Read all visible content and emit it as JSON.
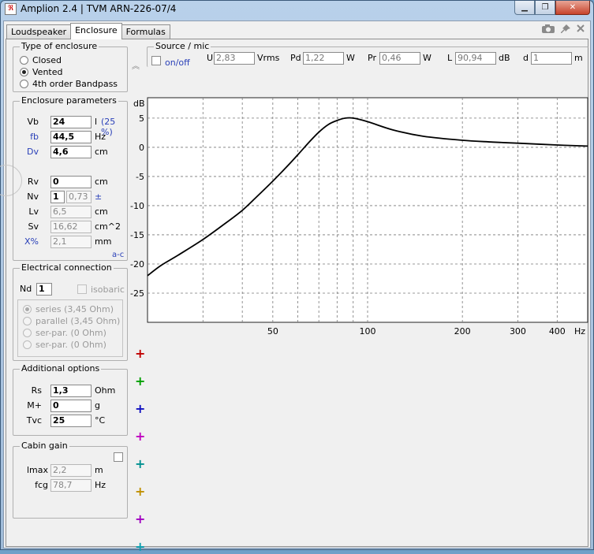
{
  "window": {
    "title": "Amplion 2.4 | TVM ARN-226-07/4",
    "app_icon_text": "ℜ",
    "minimize_glyph": "▁",
    "maximize_glyph": "❐",
    "close_glyph": "✕"
  },
  "tabs": [
    "Loudspeaker",
    "Enclosure",
    "Formulas"
  ],
  "active_tab": "Enclosure",
  "toolbar_icons": [
    "camera-icon",
    "pin-icon",
    "close-icon"
  ],
  "enclosure_type": {
    "title": "Type of enclosure",
    "options": [
      "Closed",
      "Vented",
      "4th order Bandpass"
    ],
    "selected": "Vented"
  },
  "enclosure_params": {
    "title": "Enclosure parameters",
    "Vb": {
      "label": "Vb",
      "value": "24",
      "unit": "l",
      "extra": "(25 %)"
    },
    "fb": {
      "label": "fb",
      "value": "44,5",
      "unit": "Hz"
    },
    "Dv": {
      "label": "Dv",
      "value": "4,6",
      "unit": "cm"
    },
    "Rv": {
      "label": "Rv",
      "value": "0",
      "unit": "cm"
    },
    "Nv": {
      "label": "Nv",
      "value": "1",
      "value2": "0,73",
      "unit": "±"
    },
    "Lv": {
      "label": "Lv",
      "value": "6,5",
      "unit": "cm"
    },
    "Sv": {
      "label": "Sv",
      "value": "16,62",
      "unit": "cm^2"
    },
    "Xpct": {
      "label": "X%",
      "value": "2,1",
      "unit": "mm"
    },
    "ac_label": "a-c"
  },
  "electrical": {
    "title": "Electrical connection",
    "nd_label": "Nd",
    "nd_value": "1",
    "isobaric_label": "isobaric",
    "options": [
      "series (3,45 Ohm)",
      "parallel (3,45 Ohm)",
      "ser-par. (0 Ohm)",
      "ser-par. (0 Ohm)"
    ],
    "selected": "series (3,45 Ohm)"
  },
  "additional": {
    "title": "Additional options",
    "Rs": {
      "label": "Rs",
      "value": "1,3",
      "unit": "Ohm"
    },
    "Mplus": {
      "label": "M+",
      "value": "0",
      "unit": "g"
    },
    "Tvc": {
      "label": "Tvc",
      "value": "25",
      "unit": "°C"
    }
  },
  "cabin": {
    "title": "Cabin gain",
    "lmax": {
      "label": "lmax",
      "value": "2,2",
      "unit": "m"
    },
    "fcg": {
      "label": "fcg",
      "value": "78,7",
      "unit": "Hz"
    }
  },
  "source": {
    "title": "Source / mic",
    "onoff_label": "on/off",
    "U": {
      "label": "U",
      "value": "2,83",
      "unit": "Vrms"
    },
    "Pd": {
      "label": "Pd",
      "value": "1,22",
      "unit": "W"
    },
    "Pr": {
      "label": "Pr",
      "value": "0,46",
      "unit": "W"
    },
    "L": {
      "label": "L",
      "value": "90,94",
      "unit": "dB"
    },
    "d": {
      "label": "d",
      "value": "1",
      "unit": "m"
    }
  },
  "curve_add_buttons": [
    {
      "color": "#c00000"
    },
    {
      "color": "#00a000"
    },
    {
      "color": "#1010c0"
    },
    {
      "color": "#c000c0"
    },
    {
      "color": "#009090"
    },
    {
      "color": "#c09000"
    },
    {
      "color": "#a000c0"
    },
    {
      "color": "#10a0b0"
    }
  ],
  "chart_data": {
    "type": "line",
    "xscale": "log",
    "xlim": [
      20,
      500
    ],
    "ylim": [
      -30,
      8.5
    ],
    "ylabel": "dB",
    "xlabel": "Hz",
    "yticks": [
      5,
      0,
      -5,
      -10,
      -15,
      -20,
      -25
    ],
    "xticks_labeled": [
      50,
      100,
      200,
      300,
      400
    ],
    "xgrid": [
      30,
      40,
      50,
      60,
      70,
      80,
      90,
      100,
      200,
      300,
      400
    ],
    "series": [
      {
        "color": "#000000",
        "x": [
          20,
          22,
          25,
          30,
          35,
          40,
          45,
          50,
          55,
          60,
          65,
          70,
          75,
          80,
          85,
          90,
          100,
          120,
          150,
          200,
          250,
          300,
          400,
          500
        ],
        "y": [
          -22,
          -20.3,
          -18.5,
          -15.8,
          -13.2,
          -10.8,
          -8.2,
          -5.8,
          -3.5,
          -1.3,
          0.8,
          2.6,
          3.9,
          4.6,
          5.0,
          5.0,
          4.4,
          3.0,
          1.9,
          1.2,
          0.9,
          0.7,
          0.4,
          0.2
        ]
      }
    ]
  }
}
